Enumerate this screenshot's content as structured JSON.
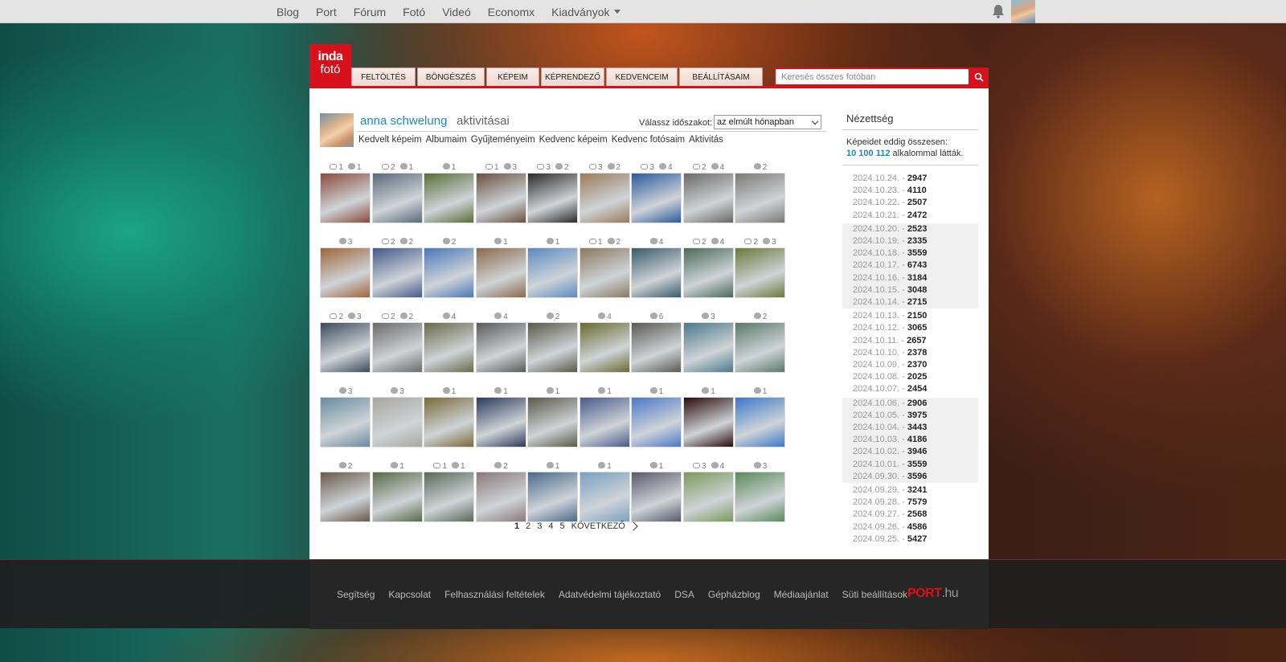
{
  "topnav": {
    "links": [
      "Blog",
      "Port",
      "Fórum",
      "Fotó",
      "Videó",
      "Economx",
      "Kiadványok"
    ]
  },
  "logo": {
    "line1": "inda",
    "line2": "fotó"
  },
  "tabs": [
    {
      "label": "Feltöltés",
      "w": 80
    },
    {
      "label": "Böngészés",
      "w": 84
    },
    {
      "label": "Képeim",
      "w": 66
    },
    {
      "label": "Képrendező",
      "w": 79
    },
    {
      "label": "Kedvenceim",
      "w": 89
    },
    {
      "label": "Beállításaim",
      "w": 104
    }
  ],
  "search": {
    "placeholder": "Keresés összes fotóban"
  },
  "profile": {
    "name": "anna schwelung",
    "activity": "aktivitásai",
    "period_label": "Válassz időszakot:",
    "period_value": "az elmúlt hónapban",
    "sublinks": [
      "Kedvelt képeim",
      "Albumaim",
      "Gyűjteményeim",
      "Kedvenc képeim",
      "Kedvenc fotósaim",
      "Aktivitás"
    ]
  },
  "photos": [
    [
      {
        "c": "1",
        "h": "1",
        "col": "#8a4a3a"
      },
      {
        "c": "2",
        "h": "1",
        "col": "#5a6a7a"
      },
      {
        "c": "",
        "h": "1",
        "col": "#5a6e3a"
      },
      {
        "c": "1",
        "h": "3",
        "col": "#6a5040"
      },
      {
        "c": "3",
        "h": "2",
        "col": "#2a2a2a"
      },
      {
        "c": "3",
        "h": "2",
        "col": "#9a7a5a"
      },
      {
        "c": "3",
        "h": "4",
        "col": "#2a5a9a"
      },
      {
        "c": "2",
        "h": "4",
        "col": "#6a6a66"
      },
      {
        "c": "",
        "h": "2",
        "col": "#7a7a74"
      }
    ],
    [
      {
        "c": "",
        "h": "3",
        "col": "#a0653a"
      },
      {
        "c": "2",
        "h": "2",
        "col": "#445a8a"
      },
      {
        "c": "",
        "h": "2",
        "col": "#4a78b8"
      },
      {
        "c": "",
        "h": "1",
        "col": "#8a6a4a"
      },
      {
        "c": "",
        "h": "1",
        "col": "#5a8ac0"
      },
      {
        "c": "1",
        "h": "2",
        "col": "#8a7a60"
      },
      {
        "c": "",
        "h": "4",
        "col": "#3a5a6a"
      },
      {
        "c": "2",
        "h": "4",
        "col": "#4a6a5a"
      },
      {
        "c": "2",
        "h": "3",
        "col": "#6a7a3a"
      }
    ],
    [
      {
        "c": "2",
        "h": "3",
        "col": "#3a4a5a"
      },
      {
        "c": "2",
        "h": "2",
        "col": "#6a6a6a"
      },
      {
        "c": "",
        "h": "4",
        "col": "#6a6a4a"
      },
      {
        "c": "",
        "h": "4",
        "col": "#5a5a5a"
      },
      {
        "c": "",
        "h": "2",
        "col": "#5a5a4a"
      },
      {
        "c": "",
        "h": "4",
        "col": "#6a6a30"
      },
      {
        "c": "",
        "h": "6",
        "col": "#5a5a52"
      },
      {
        "c": "",
        "h": "3",
        "col": "#4a7a8a"
      },
      {
        "c": "",
        "h": "2",
        "col": "#5a7a6a"
      }
    ],
    [
      {
        "c": "",
        "h": "3",
        "col": "#6a8aa0"
      },
      {
        "c": "",
        "h": "3",
        "col": "#a8a8a0"
      },
      {
        "c": "",
        "h": "1",
        "col": "#7a6a3a"
      },
      {
        "c": "",
        "h": "1",
        "col": "#2a3a5a"
      },
      {
        "c": "",
        "h": "1",
        "col": "#5a5a4a"
      },
      {
        "c": "",
        "h": "1",
        "col": "#4a5a8a"
      },
      {
        "c": "",
        "h": "1",
        "col": "#4a78c8"
      },
      {
        "c": "",
        "h": "1",
        "col": "#2a0a0a"
      },
      {
        "c": "",
        "h": "1",
        "col": "#3a78c8"
      }
    ],
    [
      {
        "c": "",
        "h": "2",
        "col": "#6a5a4a"
      },
      {
        "c": "",
        "h": "1",
        "col": "#5a6a4a"
      },
      {
        "c": "1",
        "h": "1",
        "col": "#5a6a5a"
      },
      {
        "c": "",
        "h": "2",
        "col": "#8a7a7a"
      },
      {
        "c": "",
        "h": "1",
        "col": "#4a6a8a"
      },
      {
        "c": "",
        "h": "1",
        "col": "#7aa0c0"
      },
      {
        "c": "",
        "h": "1",
        "col": "#5a5a6a"
      },
      {
        "c": "3",
        "h": "4",
        "col": "#7a9a5a"
      },
      {
        "c": "",
        "h": "3",
        "col": "#5a8a5a"
      }
    ]
  ],
  "pager": {
    "pages": [
      "1",
      "2",
      "3",
      "4",
      "5"
    ],
    "next": "KÖVETKEZŐ"
  },
  "views": {
    "title": "Nézettség",
    "total_line1": "Képeidet eddig összesen:",
    "total_num": "10 100 112",
    "total_suffix": " alkalommal látták.",
    "weeks": [
      {
        "shaded": false,
        "rows": [
          [
            "2024.10.24.",
            "2947"
          ],
          [
            "2024.10.23.",
            "4110"
          ],
          [
            "2024.10.22.",
            "2507"
          ],
          [
            "2024.10.21.",
            "2472"
          ]
        ]
      },
      {
        "shaded": true,
        "rows": [
          [
            "2024.10.20.",
            "2523"
          ],
          [
            "2024.10.19.",
            "2335"
          ],
          [
            "2024.10.18.",
            "3559"
          ],
          [
            "2024.10.17.",
            "6743"
          ],
          [
            "2024.10.16.",
            "3184"
          ],
          [
            "2024.10.15.",
            "3048"
          ],
          [
            "2024.10.14.",
            "2715"
          ]
        ]
      },
      {
        "shaded": false,
        "rows": [
          [
            "2024.10.13.",
            "2150"
          ],
          [
            "2024.10.12.",
            "3065"
          ],
          [
            "2024.10.11.",
            "2657"
          ],
          [
            "2024.10.10.",
            "2378"
          ],
          [
            "2024.10.09.",
            "2370"
          ],
          [
            "2024.10.08.",
            "2025"
          ],
          [
            "2024.10.07.",
            "2454"
          ]
        ]
      },
      {
        "shaded": true,
        "rows": [
          [
            "2024.10.06.",
            "2906"
          ],
          [
            "2024.10.05.",
            "3975"
          ],
          [
            "2024.10.04.",
            "3443"
          ],
          [
            "2024.10.03.",
            "4186"
          ],
          [
            "2024.10.02.",
            "3946"
          ],
          [
            "2024.10.01.",
            "3559"
          ],
          [
            "2024.09.30.",
            "3596"
          ]
        ]
      },
      {
        "shaded": false,
        "rows": [
          [
            "2024.09.29.",
            "3241"
          ],
          [
            "2024.09.28.",
            "7579"
          ],
          [
            "2024.09.27.",
            "2568"
          ],
          [
            "2024.09.26.",
            "4586"
          ],
          [
            "2024.09.25.",
            "5427"
          ]
        ]
      }
    ]
  },
  "footer": {
    "links": [
      "Segítség",
      "Kapcsolat",
      "Felhasználási feltételek",
      "Adatvédelmi tájékoztató",
      "DSA",
      "Gépházblog",
      "Médiaajánlat",
      "Süti beállítások"
    ],
    "logo_main": "PORT",
    "logo_dot": ".hu"
  },
  "icons": {
    "bell": "bell-icon",
    "search": "search-icon",
    "comment": "comment-icon",
    "heart": "heart-icon",
    "next": "chevron-right-icon"
  },
  "colors": {
    "accent": "#d6111c",
    "link": "#1d87bd"
  }
}
